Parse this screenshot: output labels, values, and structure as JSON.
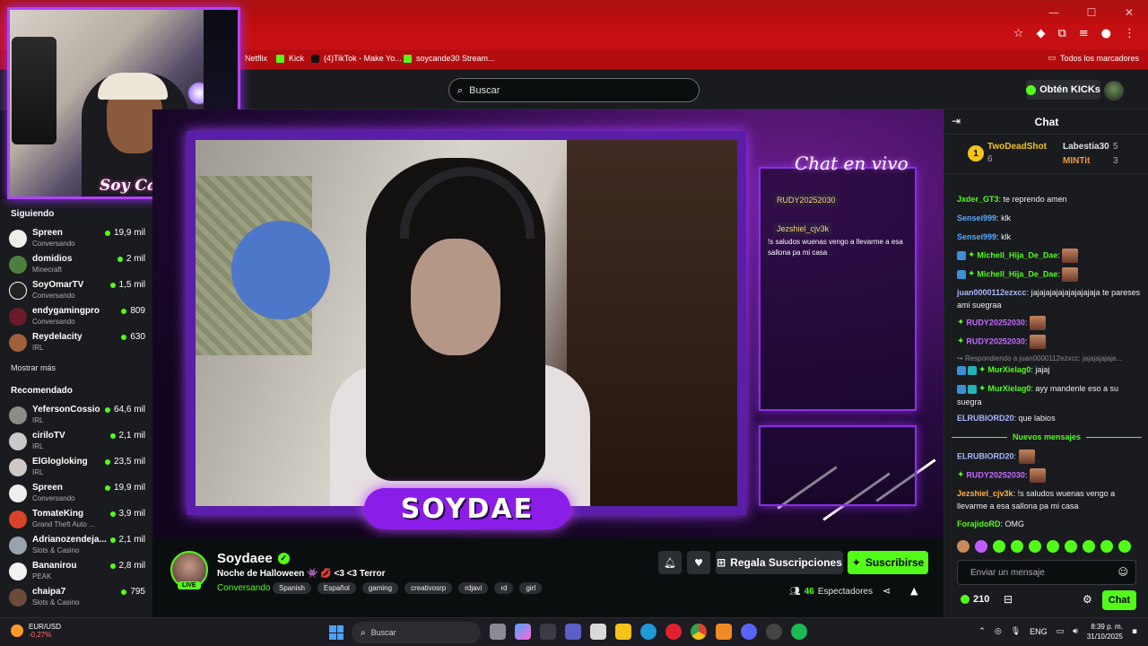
{
  "browser": {
    "bookmarks": [
      {
        "label": "Netflix",
        "icon": "netflix-icon"
      },
      {
        "label": "Kick",
        "icon": "kick-icon"
      },
      {
        "label": "(4)TikTok - Make Yo...",
        "icon": "tiktok-icon"
      },
      {
        "label": "soycande30 Stream...",
        "icon": "kick-icon"
      }
    ],
    "bookmarks_folder": "Todos los marcadores"
  },
  "nav": {
    "search_placeholder": "Buscar",
    "kicks_button": "Obtén KICKs"
  },
  "webcam_overlay_logo": "Soy Cande",
  "sidebar": {
    "following_title": "Siguiendo",
    "following": [
      {
        "name": "Spreen",
        "category": "Conversando",
        "viewers": "19,9 mil"
      },
      {
        "name": "domidios",
        "category": "Minecraft",
        "viewers": "2 mil"
      },
      {
        "name": "SoyOmarTV",
        "category": "Conversando",
        "viewers": "1,5 mil"
      },
      {
        "name": "endygamingpro",
        "category": "Conversando",
        "viewers": "809"
      },
      {
        "name": "Reydelacity",
        "category": "IRL",
        "viewers": "630"
      }
    ],
    "show_more": "Mostrar más",
    "recommended_title": "Recomendado",
    "recommended": [
      {
        "name": "YefersonCossio",
        "category": "IRL",
        "viewers": "64,6 mil"
      },
      {
        "name": "ciriloTV",
        "category": "IRL",
        "viewers": "2,1 mil"
      },
      {
        "name": "ElGlogloking",
        "category": "IRL",
        "viewers": "23,5 mil"
      },
      {
        "name": "Spreen",
        "category": "Conversando",
        "viewers": "19,9 mil"
      },
      {
        "name": "TomateKing",
        "category": "Grand Theft Auto ...",
        "viewers": "3,9 mil"
      },
      {
        "name": "Adrianozendeja...",
        "category": "Slots & Casino",
        "viewers": "2,1 mil"
      },
      {
        "name": "Bananirou",
        "category": "PEAK",
        "viewers": "2,8 mil"
      },
      {
        "name": "chaipa7",
        "category": "Slots & Casino",
        "viewers": "795"
      }
    ]
  },
  "stream_overlay": {
    "chat_title": "Chat en vivo",
    "name_plate": "SOYDAE",
    "messages": [
      {
        "user": "RUDY20252030",
        "text": ""
      },
      {
        "user": "Jezshiel_cjv3k",
        "text": "!s saludos wuenas vengo a llevarme a esa sallona pa mi casa"
      }
    ]
  },
  "stream_info": {
    "streamer": "Soydaee",
    "live_label": "LIVE",
    "title": "Noche de Halloween 👾 💋 <3 <3 Terror",
    "category": "Conversando",
    "tags": [
      "Spanish",
      "Español",
      "gaming",
      "creativosrp",
      "rdjavi",
      "rd",
      "girl"
    ],
    "gift_button": "Regala Suscripciones",
    "subscribe_button": "Suscribirse",
    "viewers_count": "46",
    "viewers_label": "Espectadores"
  },
  "chat": {
    "title": "Chat",
    "leaderboard": [
      {
        "rank": "1",
        "name": "TwoDeadShot",
        "value": "6"
      },
      {
        "name": "Labestia30",
        "value": "5"
      },
      {
        "name": "MINTit",
        "value": "3"
      }
    ],
    "messages": [
      {
        "user": "Jxder_GT3",
        "text": "te reprendo amen",
        "color": "#53fc18"
      },
      {
        "user": "Sensei999",
        "text": "klk",
        "color": "#5aa9ff"
      },
      {
        "user": "Sensei999",
        "text": "klk",
        "color": "#5aa9ff"
      },
      {
        "user": "Michell_Hija_De_Dae",
        "text": "",
        "color": "#53fc18"
      },
      {
        "user": "Michell_Hija_De_Dae",
        "text": "",
        "color": "#53fc18"
      },
      {
        "user": "juan0000112ezxcc",
        "text": "jajajajajajajajajajaja te pareses ami suegraa",
        "color": "#a9b8ff"
      },
      {
        "user": "RUDY20252030",
        "text": "",
        "color": "#c26bff"
      },
      {
        "user": "RUDY20252030",
        "text": "",
        "color": "#c26bff"
      },
      {
        "user": "Respondiendo a juan0000112ezxcc: jajajajajaja...",
        "text": "",
        "color": "#8a8a94"
      },
      {
        "user": "MurXielag0",
        "text": "jajaj",
        "color": "#53fc18"
      },
      {
        "user": "MurXielag0",
        "text": "ayy mandenle eso a su suegra",
        "color": "#53fc18"
      },
      {
        "user": "ELRUBIORD20",
        "text": "que labios",
        "color": "#a9b8ff"
      },
      {
        "user": "ELRUBIORD20",
        "text": "",
        "color": "#a9b8ff"
      },
      {
        "user": "RUDY20252030",
        "text": "",
        "color": "#c26bff"
      },
      {
        "user": "Jezshiel_cjv3k",
        "text": "!s saludos wuenas vengo a llevarme a esa sallona pa mi casa",
        "color": "#ffb14a"
      },
      {
        "user": "ForajidoRD",
        "text": "OMG",
        "color": "#53fc18"
      }
    ],
    "new_messages": "Nuevos mensajes",
    "input_placeholder": "Enviar un mensaje",
    "points": "210",
    "send_button": "Chat"
  },
  "taskbar": {
    "ticker": "EUR/USD",
    "ticker_change": "-0,27%",
    "search_placeholder": "Buscar",
    "language": "ENG",
    "time": "8:39 p. m.",
    "date": "31/10/2025"
  },
  "colors": {
    "accent": "#53fc18",
    "browser_red": "#c60f12",
    "overlay_purple": "#8a1ee8"
  }
}
